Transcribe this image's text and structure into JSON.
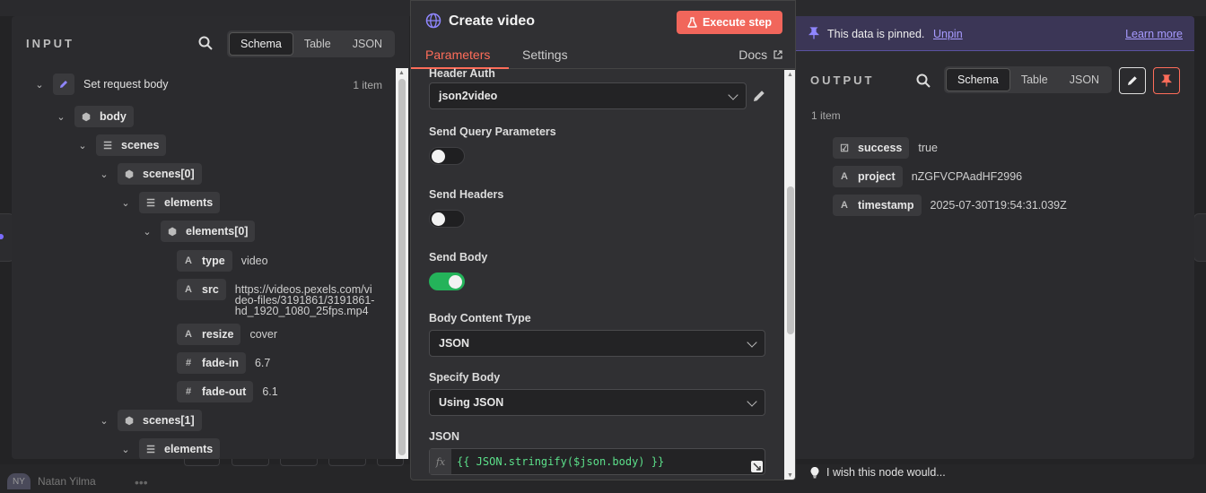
{
  "background": {
    "user_initials": "NY",
    "user_name": "Natan Yilma",
    "more": "•••"
  },
  "input": {
    "title": "INPUT",
    "tabs": [
      "Schema",
      "Table",
      "JSON"
    ],
    "active_tab": "Schema",
    "item_count": "1 item",
    "tree": {
      "root": "Set request body",
      "body": "body",
      "scenes": "scenes",
      "scene0": "scenes[0]",
      "elements": "elements",
      "element0": "elements[0]",
      "fields": [
        {
          "type": "A",
          "key": "type",
          "value": "video"
        },
        {
          "type": "A",
          "key": "src",
          "value": "https://videos.pexels.com/video-files/3191861/3191861-hd_1920_1080_25fps.mp4",
          "lines": [
            "https://videos.pexels.com/vi",
            "deo-files/3191861/3191861-",
            "hd_1920_1080_25fps.mp4"
          ]
        },
        {
          "type": "A",
          "key": "resize",
          "value": "cover"
        },
        {
          "type": "#",
          "key": "fade-in",
          "value": "6.7"
        },
        {
          "type": "#",
          "key": "fade-out",
          "value": "6.1"
        }
      ],
      "scene1": "scenes[1]",
      "elements2": "elements"
    }
  },
  "node": {
    "title": "Create video",
    "execute_label": "Execute step",
    "tabs": [
      "Parameters",
      "Settings"
    ],
    "active_tab": "Parameters",
    "docs_label": "Docs",
    "header_auth_label": "Header Auth",
    "header_auth_value": "json2video",
    "send_query_label": "Send Query Parameters",
    "send_query_on": false,
    "send_headers_label": "Send Headers",
    "send_headers_on": false,
    "send_body_label": "Send Body",
    "send_body_on": true,
    "body_content_type_label": "Body Content Type",
    "body_content_type_value": "JSON",
    "specify_body_label": "Specify Body",
    "specify_body_value": "Using JSON",
    "json_label": "JSON",
    "json_fx": "fx",
    "json_expression": "{{ JSON.stringify($json.body) }}"
  },
  "output": {
    "pinned_text": "This data is pinned.",
    "unpin_label": "Unpin",
    "learn_more_label": "Learn more",
    "title": "OUTPUT",
    "tabs": [
      "Schema",
      "Table",
      "JSON"
    ],
    "active_tab": "Schema",
    "item_count": "1 item",
    "fields": [
      {
        "type": "☑",
        "key": "success",
        "value": "true"
      },
      {
        "type": "A",
        "key": "project",
        "value": "nZGFVCPAadHF2996"
      },
      {
        "type": "A",
        "key": "timestamp",
        "value": "2025-07-30T19:54:31.039Z"
      }
    ],
    "accent_pin_color": "#ff6d5a"
  },
  "footer": {
    "tip": "I wish this node would..."
  }
}
